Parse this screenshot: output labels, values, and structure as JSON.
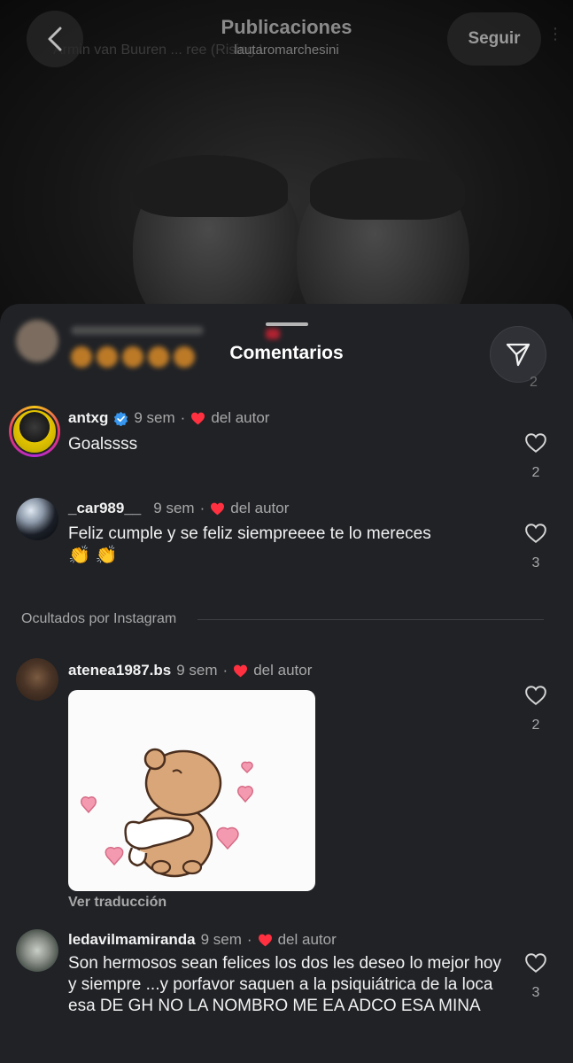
{
  "header": {
    "title": "Publicaciones",
    "subtitle": "lautaromarchesini",
    "follow_label": "Seguir",
    "ghost_text": "Armin van Buuren ... ree (Rising L"
  },
  "sheet": {
    "title": "Comentarios",
    "ghost_count": "2"
  },
  "comments": [
    {
      "username": "antxg",
      "verified": true,
      "time": "9 sem",
      "author_like": "del autor",
      "text": "Goalssss",
      "likes": "2"
    },
    {
      "username": "_car989__",
      "verified": false,
      "time": "9 sem",
      "author_like": "del autor",
      "text": "Feliz cumple y se feliz siempreeee te lo mereces",
      "emoji": "👏 👏",
      "likes": "3"
    },
    {
      "username": "atenea1987.bs",
      "verified": false,
      "time": "9 sem",
      "author_like": "del autor",
      "text": "",
      "likes": "2",
      "translate_label": "Ver traducción"
    },
    {
      "username": "ledavilmamiranda",
      "verified": false,
      "time": "9 sem",
      "author_like": "del autor",
      "text": "Son hermosos sean felices los dos les deseo lo mejor hoy y siempre ...y porfavor saquen  a la psiquiátrica de la loca esa DE GH NO LA NOMBRO ME EA ADCO ESA MINA",
      "likes": "3"
    }
  ],
  "hidden_section": {
    "label": "Ocultados por Instagram"
  },
  "colors": {
    "sheet_bg": "#202226",
    "heart_red": "#ff3040",
    "verified_blue": "#3797f0"
  }
}
